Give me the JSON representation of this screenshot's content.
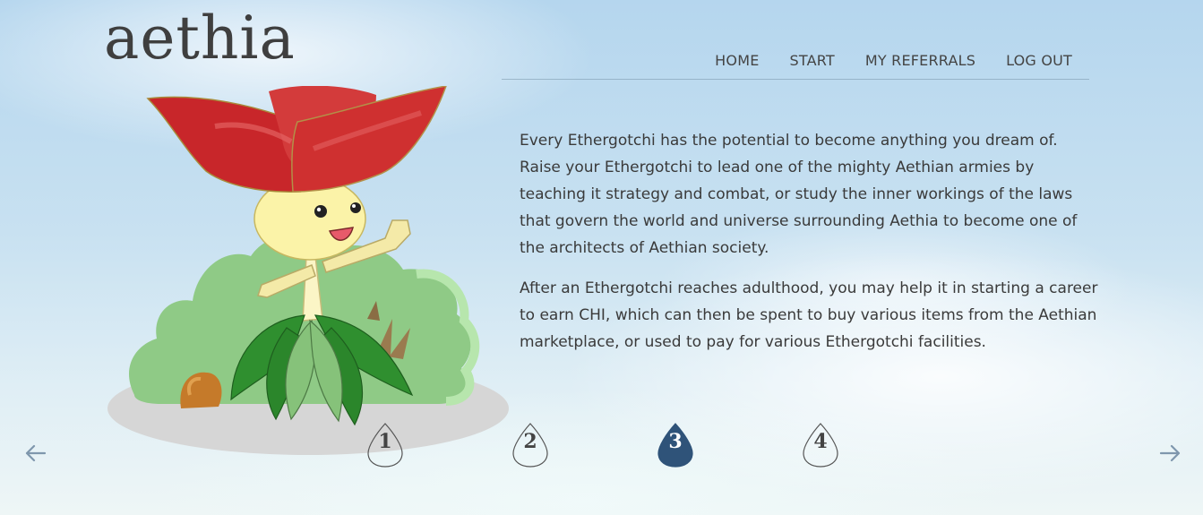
{
  "brand": {
    "logo_text": "aethia"
  },
  "nav": {
    "items": [
      {
        "label": "HOME"
      },
      {
        "label": "START"
      },
      {
        "label": "MY REFERRALS"
      },
      {
        "label": "LOG OUT"
      }
    ]
  },
  "content": {
    "paragraphs": [
      "Every Ethergotchi has the potential to become anything you dream of. Raise your Ethergotchi to lead one of the mighty Aethian armies by teaching it strategy and combat, or study the inner workings of the laws that govern the world and universe surrounding Aethia to become one of the architects of Aethian society.",
      "After an Ethergotchi reaches adulthood, you may help it in starting a career to earn CHI, which can then be spent to buy various items from the Aethian marketplace, or used to pay for various Ethergotchi facilities."
    ]
  },
  "pager": {
    "pages": [
      "1",
      "2",
      "3",
      "4"
    ],
    "active_page": "3",
    "active_color": "#2f5379"
  },
  "icons": {
    "prev": "arrow-left-icon",
    "next": "arrow-right-icon",
    "mascot": "ethergotchi-flower-illustration"
  },
  "colors": {
    "text": "#3a3a3a",
    "arrow": "#7f97ad",
    "petal": "#c92a2a",
    "leaf": "#2f8f2f"
  }
}
